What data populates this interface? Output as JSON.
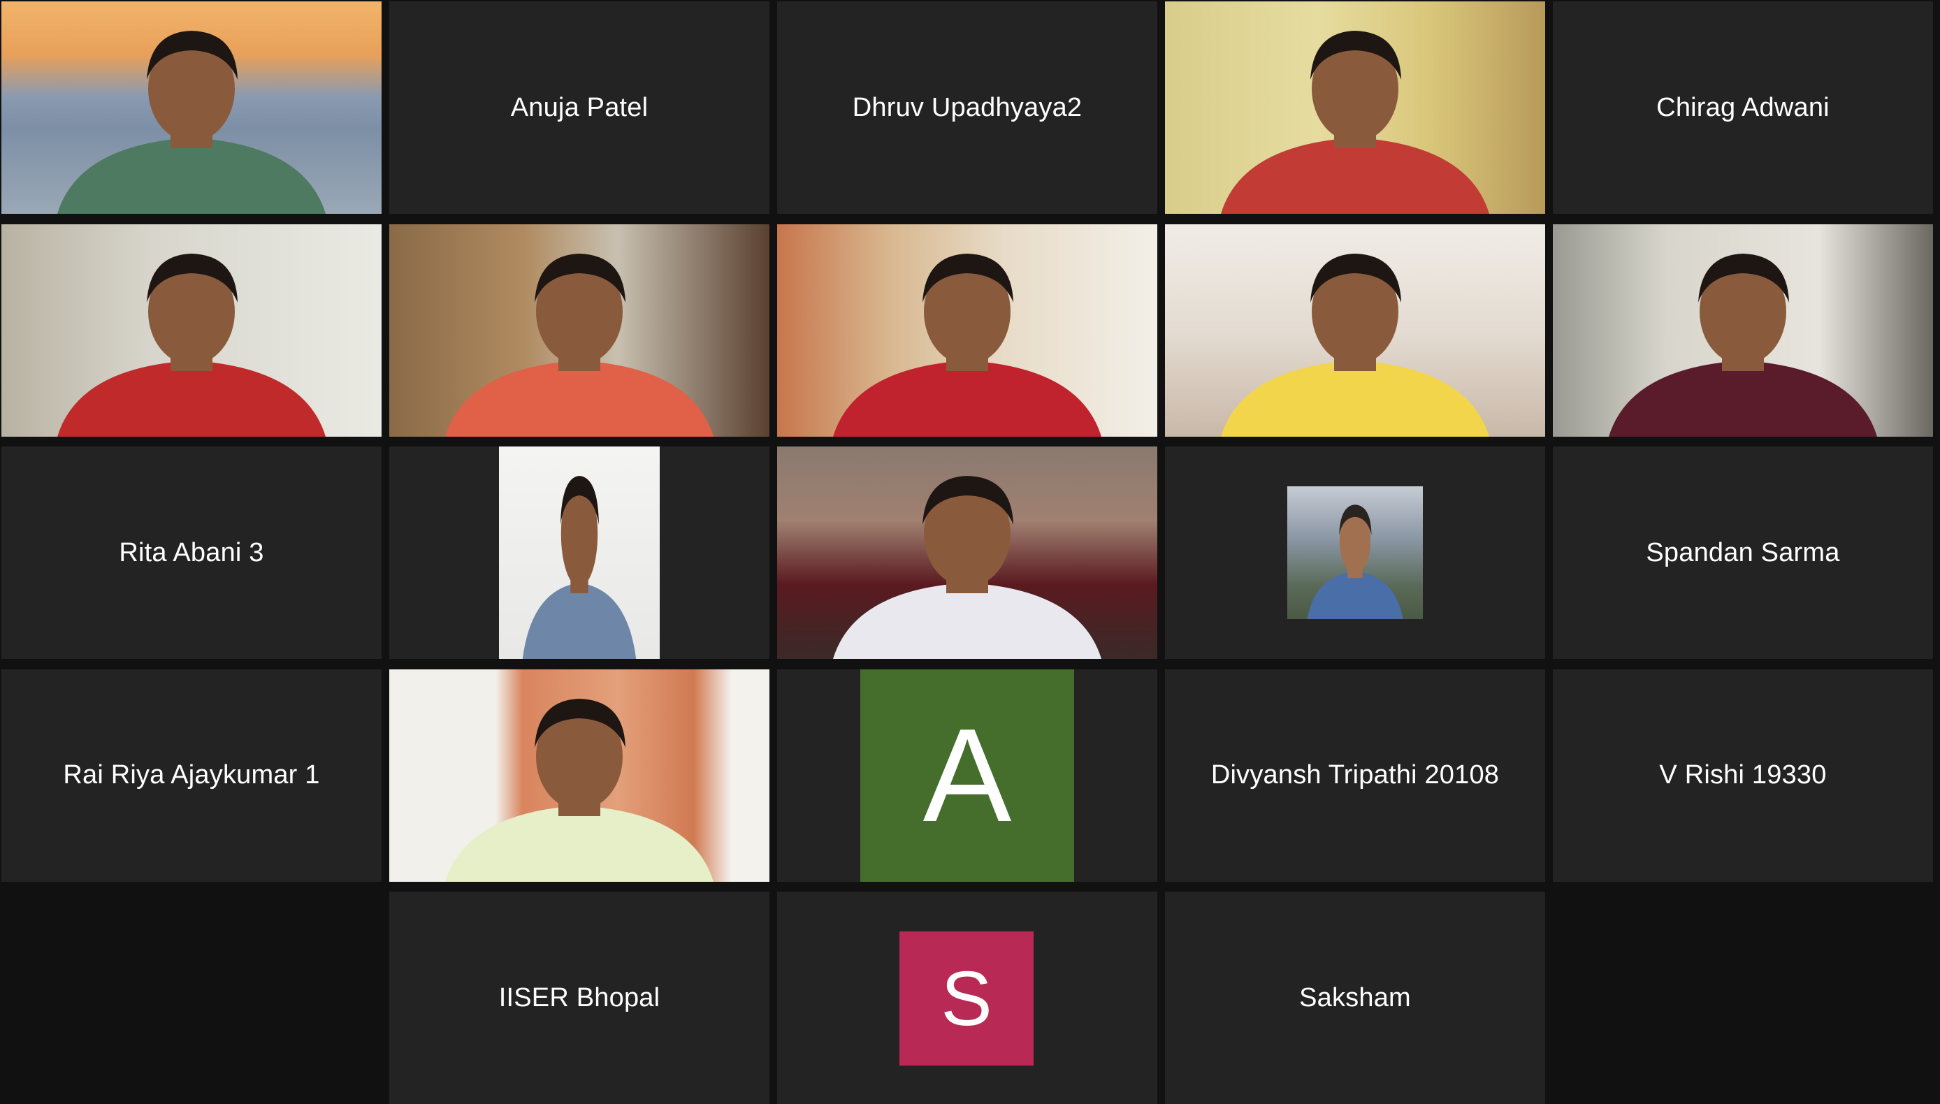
{
  "participants": [
    {
      "name": "",
      "type": "video",
      "active": true,
      "scene": "bridge",
      "shirt": "#4e7a62"
    },
    {
      "name": "Anuja Patel",
      "type": "name"
    },
    {
      "name": "Dhruv Upadhyaya2",
      "type": "name"
    },
    {
      "name": "",
      "type": "video",
      "scene": "room-yellow",
      "shirt": "#c23b34"
    },
    {
      "name": "Chirag Adwani",
      "type": "name"
    },
    {
      "name": "",
      "type": "video",
      "scene": "blur-white",
      "shirt": "#c02a2a"
    },
    {
      "name": "",
      "type": "video",
      "scene": "wardrobe",
      "shirt": "#e06048"
    },
    {
      "name": "",
      "type": "video",
      "scene": "curtain",
      "shirt": "#c0232d"
    },
    {
      "name": "",
      "type": "video",
      "scene": "ceiling",
      "shirt": "#f2d54a"
    },
    {
      "name": "",
      "type": "video",
      "scene": "shelves",
      "shirt": "#5a1c2a"
    },
    {
      "name": "Rita Abani 3",
      "type": "name"
    },
    {
      "name": "",
      "type": "video-portrait",
      "scene": "white-wall",
      "shirt": "#6e86a8"
    },
    {
      "name": "",
      "type": "video",
      "scene": "maroon-room",
      "shirt": "#e8e8ee"
    },
    {
      "name": "",
      "type": "photo",
      "scene": "mountain",
      "shirt": "#4a6ea8"
    },
    {
      "name": "Spandan Sarma",
      "type": "name"
    },
    {
      "name": "Rai Riya Ajaykumar 1",
      "type": "name"
    },
    {
      "name": "",
      "type": "video",
      "scene": "orange-curtain",
      "shirt": "#e6efc8"
    },
    {
      "name": "",
      "type": "avatar",
      "letter": "A",
      "color": "#456e2d"
    },
    {
      "name": "Divyansh Tripathi 20108",
      "type": "name"
    },
    {
      "name": "V Rishi 19330",
      "type": "name"
    },
    {
      "name": "IISER Bhopal",
      "type": "name"
    },
    {
      "name": "",
      "type": "avatar",
      "letter": "S",
      "color": "#b82a55"
    },
    {
      "name": "Saksham",
      "type": "name"
    }
  ]
}
